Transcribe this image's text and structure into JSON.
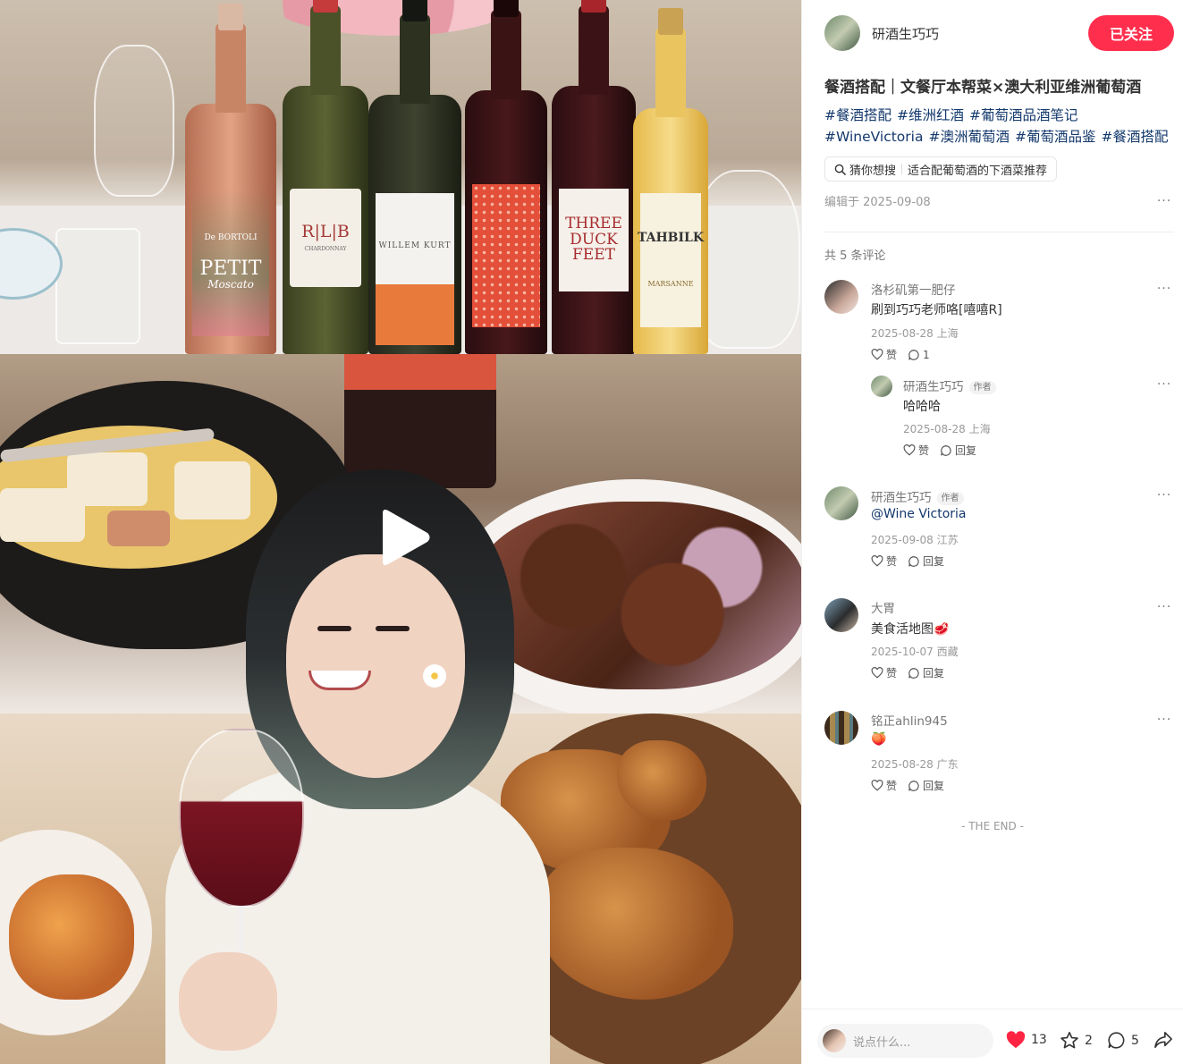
{
  "author": {
    "name": "研酒生巧巧",
    "follow_label": "已关注"
  },
  "note": {
    "title": "餐酒搭配｜文餐厅本帮菜×澳大利亚维洲葡萄酒",
    "tags": [
      "#餐酒搭配",
      "#维洲红酒",
      "#葡萄酒品酒笔记",
      "#WineVictoria",
      "#澳洲葡萄酒",
      "#葡萄酒品鉴",
      "#餐酒搭配"
    ],
    "search_chip": {
      "prefix": "猜你想搜",
      "query": "适合配葡萄酒的下酒菜推荐"
    },
    "edited": "编辑于 2025-09-08"
  },
  "media": {
    "bottles": [
      {
        "label_top": "De BORTOLI",
        "label_main": "PETIT",
        "label_sub": "Moscato"
      },
      {
        "label_main": "R|L|B",
        "label_sub": "CHARDONNAY"
      },
      {
        "label_main": "WILLEM KURT"
      },
      {
        "label_main": ""
      },
      {
        "label_main": "THREE DUCK FEET"
      },
      {
        "label_main": "TAHBILK",
        "label_sub": "MARSANNE"
      }
    ]
  },
  "comments_header": "共 5 条评论",
  "comments": [
    {
      "name": "洛杉矶第一肥仔",
      "text": "刷到巧巧老师咯[嘻嘻R]",
      "date": "2025-08-28",
      "location": "上海",
      "like_label": "赞",
      "reply_label": "1"
    },
    {
      "name": "研酒生巧巧",
      "tag": "作者",
      "text": "哈哈哈",
      "date": "2025-08-28",
      "location": "上海",
      "like_label": "赞",
      "reply_label": "回复"
    },
    {
      "name": "研酒生巧巧",
      "tag": "作者",
      "text": "@Wine Victoria",
      "date": "2025-09-08",
      "location": "江苏",
      "like_label": "赞",
      "reply_label": "回复"
    },
    {
      "name": "大胃",
      "text": "美食活地图🥩",
      "date": "2025-10-07",
      "location": "西藏",
      "like_label": "赞",
      "reply_label": "回复"
    },
    {
      "name": "铭正ahlin945",
      "text": "🍑",
      "date": "2025-08-28",
      "location": "广东",
      "like_label": "赞",
      "reply_label": "回复"
    }
  ],
  "the_end": "- THE END -",
  "bottom_bar": {
    "placeholder": "说点什么...",
    "likes": "13",
    "collects": "2",
    "comments": "5"
  },
  "colors": {
    "accent": "#ff2e4d",
    "tag": "#13386c",
    "like_heart": "#ff2442"
  }
}
